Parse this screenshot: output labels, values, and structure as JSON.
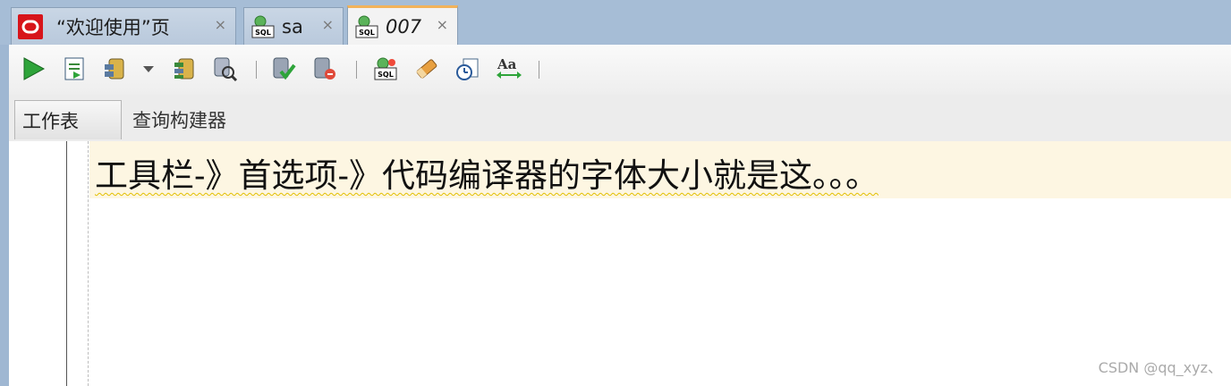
{
  "tabs": [
    {
      "label": "“欢迎使用”页",
      "icon": "oracle-logo-icon",
      "active": false
    },
    {
      "label": "sa",
      "icon": "sql-worksheet-icon",
      "active": false
    },
    {
      "label": "007",
      "icon": "sql-worksheet-icon",
      "active": true
    }
  ],
  "close_glyph": "×",
  "toolbar": {
    "buttons": [
      "run-statement-icon",
      "run-script-icon",
      "commit-icon",
      "dropdown-arrow-icon",
      "rollback-icon",
      "explain-plan-icon",
      "autotrace-icon",
      "clear-icon",
      "sql-history-icon",
      "eraser-icon",
      "sql-tuning-icon",
      "format-case-icon"
    ]
  },
  "subtabs": [
    {
      "label": "工作表"
    },
    {
      "label": "查询构建器"
    }
  ],
  "editor": {
    "line1": "工具栏-》首选项-》代码编译器的字体大小就是这。。。"
  },
  "watermark": "CSDN @qq_xyz、"
}
